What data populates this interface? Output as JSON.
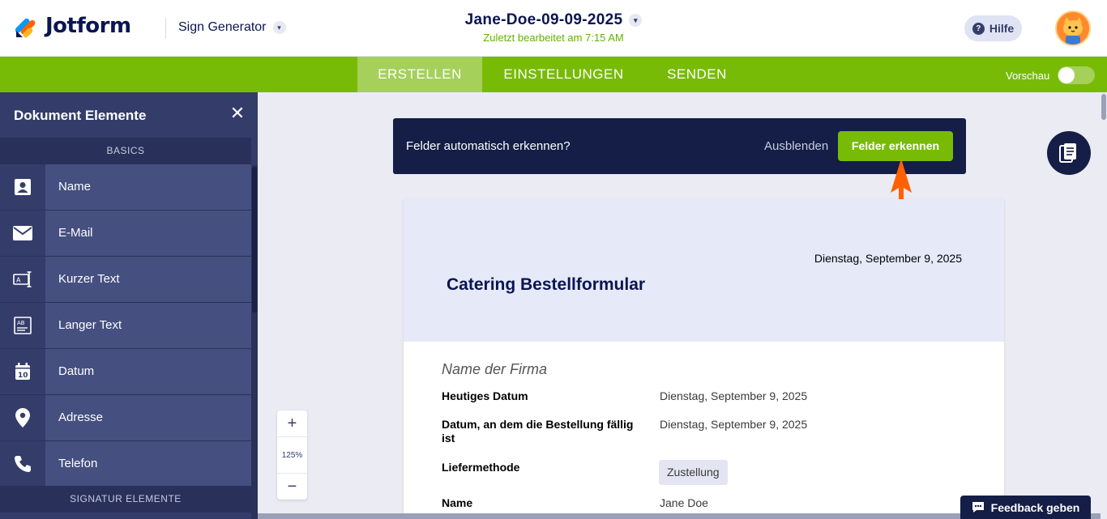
{
  "header": {
    "logo_text": "Jotform",
    "app_switcher_label": "Sign Generator",
    "doc_title": "Jane-Doe-09-09-2025",
    "doc_subtitle": "Zuletzt bearbeitet am 7:15 AM",
    "help_label": "Hilfe"
  },
  "nav": {
    "tabs": [
      {
        "label": "ERSTELLEN",
        "active": true
      },
      {
        "label": "EINSTELLUNGEN",
        "active": false
      },
      {
        "label": "SENDEN",
        "active": false
      }
    ],
    "preview_label": "Vorschau"
  },
  "sidebar": {
    "title": "Dokument Elemente",
    "section_basics": "BASICS",
    "section_signature": "SIGNATUR ELEMENTE",
    "items": [
      {
        "label": "Name",
        "icon": "contact-card-icon"
      },
      {
        "label": "E-Mail",
        "icon": "envelope-icon"
      },
      {
        "label": "Kurzer Text",
        "icon": "short-text-icon"
      },
      {
        "label": "Langer Text",
        "icon": "long-text-icon"
      },
      {
        "label": "Datum",
        "icon": "calendar-icon"
      },
      {
        "label": "Adresse",
        "icon": "location-pin-icon"
      },
      {
        "label": "Telefon",
        "icon": "phone-icon"
      }
    ]
  },
  "banner": {
    "text": "Felder automatisch erkennen?",
    "hide_label": "Ausblenden",
    "action_label": "Felder erkennen"
  },
  "document": {
    "date": "Dienstag, September 9, 2025",
    "title": "Catering Bestellformular",
    "company_placeholder": "Name der Firma",
    "rows": [
      {
        "label": "Heutiges Datum",
        "value": "Dienstag, September 9, 2025"
      },
      {
        "label": "Datum, an dem die Bestellung fällig ist",
        "value": "Dienstag, September 9, 2025"
      },
      {
        "label": "Liefermethode",
        "value": "Zustellung"
      },
      {
        "label": "Name",
        "value": "Jane Doe"
      }
    ]
  },
  "zoom": {
    "plus": "+",
    "level": "125%",
    "minus": "−"
  },
  "feedback_label": "Feedback geben",
  "colors": {
    "brand_green": "#78bb07",
    "navy": "#141e46",
    "sidebar": "#343c6a",
    "arrow": "#ff6100"
  }
}
